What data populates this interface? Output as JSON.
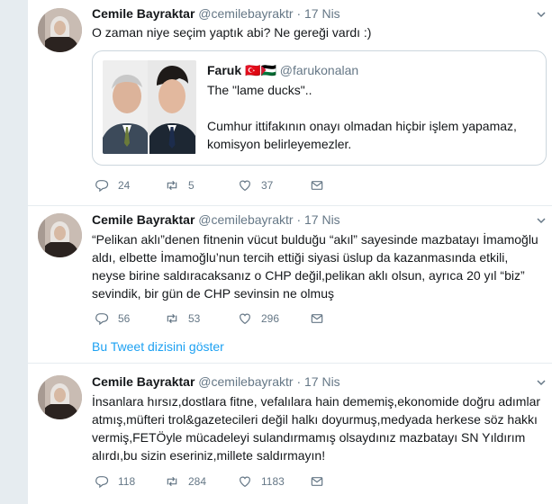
{
  "colors": {
    "sidebar": "#e6ecf0",
    "link": "#1da1f2",
    "muted": "#657786"
  },
  "tweets": [
    {
      "name": "Cemile Bayraktar",
      "handle": "@cemilebayraktr",
      "dot": "·",
      "date": "17 Nis",
      "text": "O zaman niye seçim yaptık abi? Ne gereği vardı :)",
      "quote": {
        "name": "Faruk",
        "flags": "🇹🇷🇵🇸",
        "handle": "@farukonalan",
        "line1": "The \"lame ducks\"..",
        "line2": "Cumhur ittifakının onayı olmadan hiçbir işlem yapamaz, komisyon belirleyemezler."
      },
      "replies": "24",
      "retweets": "5",
      "likes": "37"
    },
    {
      "name": "Cemile Bayraktar",
      "handle": "@cemilebayraktr",
      "dot": "·",
      "date": "17 Nis",
      "text": "“Pelikan aklı”denen fitnenin vücut bulduğu “akıl” sayesinde mazbatayı İmamoğlu aldı, elbette İmamoğlu’nun tercih ettiği siyasi üslup da kazanmasında etkili, neyse birine saldıracaksanız o CHP değil,pelikan aklı olsun, ayrıca 20 yıl “biz” sevindik, bir gün de CHP sevinsin ne olmuş",
      "replies": "56",
      "retweets": "53",
      "likes": "296",
      "thread_link": "Bu Tweet dizisini göster"
    },
    {
      "name": "Cemile Bayraktar",
      "handle": "@cemilebayraktr",
      "dot": "·",
      "date": "17 Nis",
      "text": "İnsanlara hırsız,dostlara fitne, vefalılara hain dememiş,ekonomide doğru adımlar atmış,müfteri trol&gazetecileri değil halkı doyurmuş,medyada herkese söz hakkı vermiş,FETÖyle mücadeleyi sulandırmamış olsaydınız mazbatayı SN Yıldırım alırdı,bu sizin eseriniz,millete saldırmayın!",
      "replies": "118",
      "retweets": "284",
      "likes": "1183"
    }
  ]
}
